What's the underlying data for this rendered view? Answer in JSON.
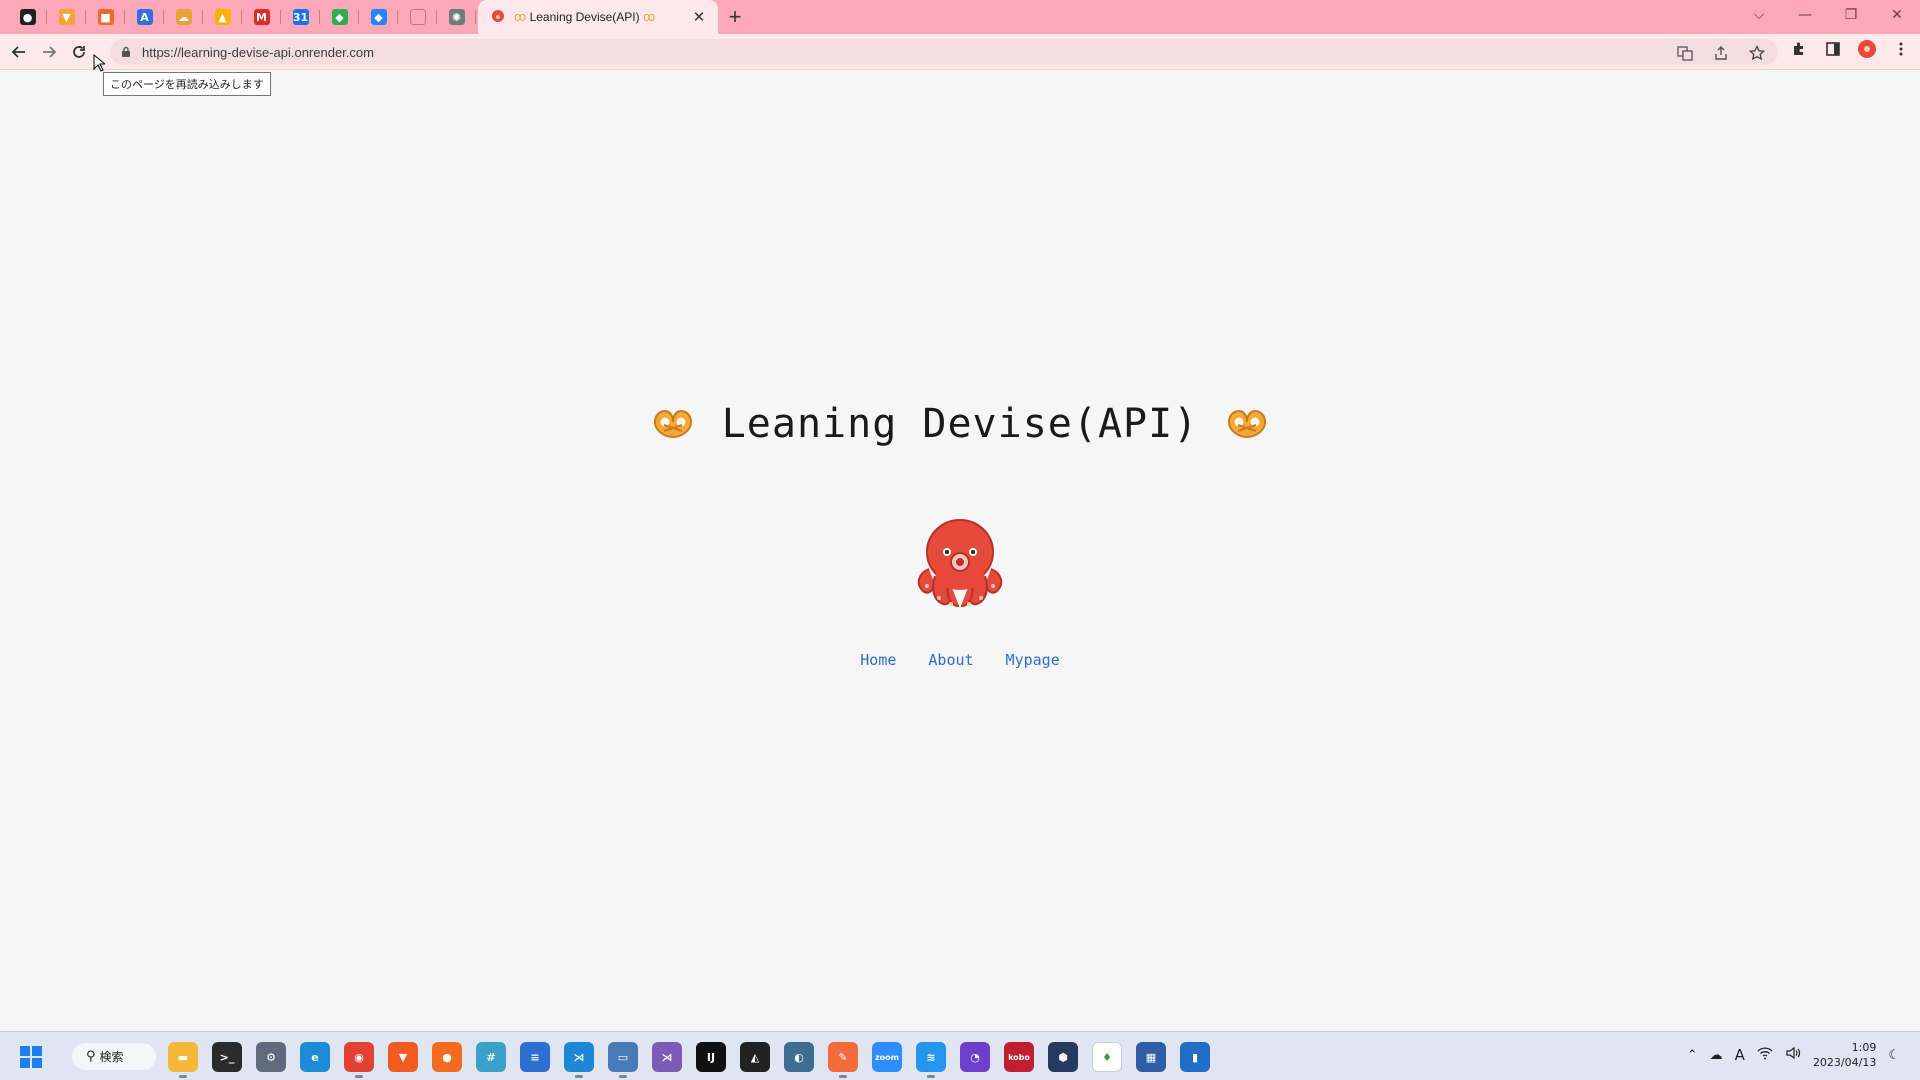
{
  "browser": {
    "active_tab_title": "Leaning Devise(API)",
    "url": "https://learning-devise-api.onrender.com",
    "reload_tooltip": "このページを再読み込みします",
    "pinned_tabs": [
      {
        "icon": "github-icon",
        "color": "#222222",
        "glyph": "●"
      },
      {
        "icon": "gitlab-icon",
        "color": "#f6a33a",
        "glyph": "▼"
      },
      {
        "icon": "box-icon",
        "color": "#e86a2c",
        "glyph": "■"
      },
      {
        "icon": "atlassian-icon",
        "color": "#2f6fe0",
        "glyph": "A"
      },
      {
        "icon": "cloud-icon",
        "color": "#e8a23a",
        "glyph": "☁"
      },
      {
        "icon": "firebase-icon",
        "color": "#f5b400",
        "glyph": "▲"
      },
      {
        "icon": "gmail-icon",
        "color": "#d93025",
        "glyph": "M"
      },
      {
        "icon": "calendar-icon",
        "color": "#1a73e8",
        "glyph": "31"
      },
      {
        "icon": "maps-icon",
        "color": "#34a853",
        "glyph": "◆"
      },
      {
        "icon": "jira-icon",
        "color": "#2684ff",
        "glyph": "◆"
      },
      {
        "icon": "blank-page-icon",
        "color": "#cccccc",
        "glyph": ""
      },
      {
        "icon": "chatgpt-icon",
        "color": "#6e7c7c",
        "glyph": "✺"
      }
    ]
  },
  "page": {
    "heading": "Leaning Devise(API)",
    "nav_links": [
      {
        "label": "Home"
      },
      {
        "label": "About"
      },
      {
        "label": "Mypage"
      }
    ]
  },
  "taskbar": {
    "search_label": "検索",
    "apps": [
      {
        "icon": "file-explorer-icon",
        "color": "#f3b83a",
        "glyph": "▬",
        "running": true
      },
      {
        "icon": "terminal-icon",
        "color": "#2b2b2b",
        "glyph": ">_",
        "running": false
      },
      {
        "icon": "settings-icon",
        "color": "#5d6b7d",
        "glyph": "⚙",
        "running": false
      },
      {
        "icon": "edge-icon",
        "color": "#1f8ad7",
        "glyph": "e",
        "running": false
      },
      {
        "icon": "chrome-icon",
        "color": "#e34133",
        "glyph": "◉",
        "running": true
      },
      {
        "icon": "brave-icon",
        "color": "#f25a22",
        "glyph": "▼",
        "running": false
      },
      {
        "icon": "firefox-icon",
        "color": "#f36b21",
        "glyph": "●",
        "running": false
      },
      {
        "icon": "slack-icon",
        "color": "#3aa1c9",
        "glyph": "#",
        "running": false
      },
      {
        "icon": "notepad-icon",
        "color": "#2e6fd1",
        "glyph": "≡",
        "running": false
      },
      {
        "icon": "vscode-icon",
        "color": "#1e86d6",
        "glyph": "⋊",
        "running": true
      },
      {
        "icon": "remote-desktop-icon",
        "color": "#4a79b8",
        "glyph": "▭",
        "running": true
      },
      {
        "icon": "visual-studio-icon",
        "color": "#7b5bb5",
        "glyph": "⋊",
        "running": false
      },
      {
        "icon": "intellij-icon",
        "color": "#111111",
        "glyph": "IJ",
        "running": false
      },
      {
        "icon": "inkscape-icon",
        "color": "#222222",
        "glyph": "◭",
        "running": false
      },
      {
        "icon": "pgadmin-icon",
        "color": "#3e6d91",
        "glyph": "◐",
        "running": false
      },
      {
        "icon": "postman-icon",
        "color": "#f26b3a",
        "glyph": "✎",
        "running": true
      },
      {
        "icon": "zoom-icon",
        "color": "#2d8cff",
        "glyph": "zoom",
        "running": false
      },
      {
        "icon": "docker-icon",
        "color": "#2496ed",
        "glyph": "≋",
        "running": true
      },
      {
        "icon": "github-desktop-icon",
        "color": "#6e40c9",
        "glyph": "◔",
        "running": false
      },
      {
        "icon": "kobo-icon",
        "color": "#bf1f2f",
        "glyph": "kobo",
        "running": false
      },
      {
        "icon": "shield-app-icon",
        "color": "#253a5e",
        "glyph": "⬢",
        "running": false
      },
      {
        "icon": "mongodb-icon",
        "color": "#ffffff",
        "glyph": "♦",
        "running": false
      },
      {
        "icon": "diagram-app-icon",
        "color": "#2e5fa6",
        "glyph": "▦",
        "running": false
      },
      {
        "icon": "monitor-app-icon",
        "color": "#1f6fc9",
        "glyph": "▮",
        "running": false
      }
    ],
    "time": "1:09",
    "date": "2023/04/13",
    "ime_label": "A"
  },
  "colors": {
    "tabstrip": "#fda8b6",
    "toolbar": "#fde9ec",
    "page_bg": "#f5f6f5",
    "link": "#2f6fc9",
    "octopus": "#e64a3b"
  }
}
